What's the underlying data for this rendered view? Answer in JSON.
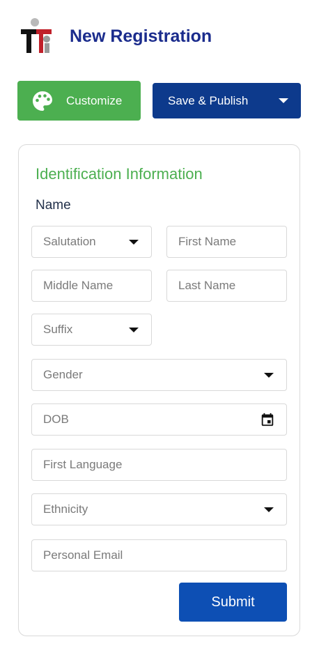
{
  "header": {
    "title": "New Registration",
    "logo": "registration-logo"
  },
  "toolbar": {
    "customize_label": "Customize",
    "customize_icon": "palette-icon",
    "publish_label": "Save & Publish",
    "publish_icon": "chevron-down-icon"
  },
  "form": {
    "section_title": "Identification Information",
    "name_label": "Name",
    "salutation": "Salutation",
    "first_name": "First Name",
    "middle_name": "Middle Name",
    "last_name": "Last Name",
    "suffix": "Suffix",
    "gender": "Gender",
    "dob": "DOB",
    "first_language": "First Language",
    "ethnicity": "Ethnicity",
    "personal_email": "Personal Email",
    "submit_label": "Submit"
  },
  "colors": {
    "primary": "#0d3a8c",
    "submit": "#0d4fb4",
    "success": "#4caf50",
    "title": "#1b2c8d"
  }
}
